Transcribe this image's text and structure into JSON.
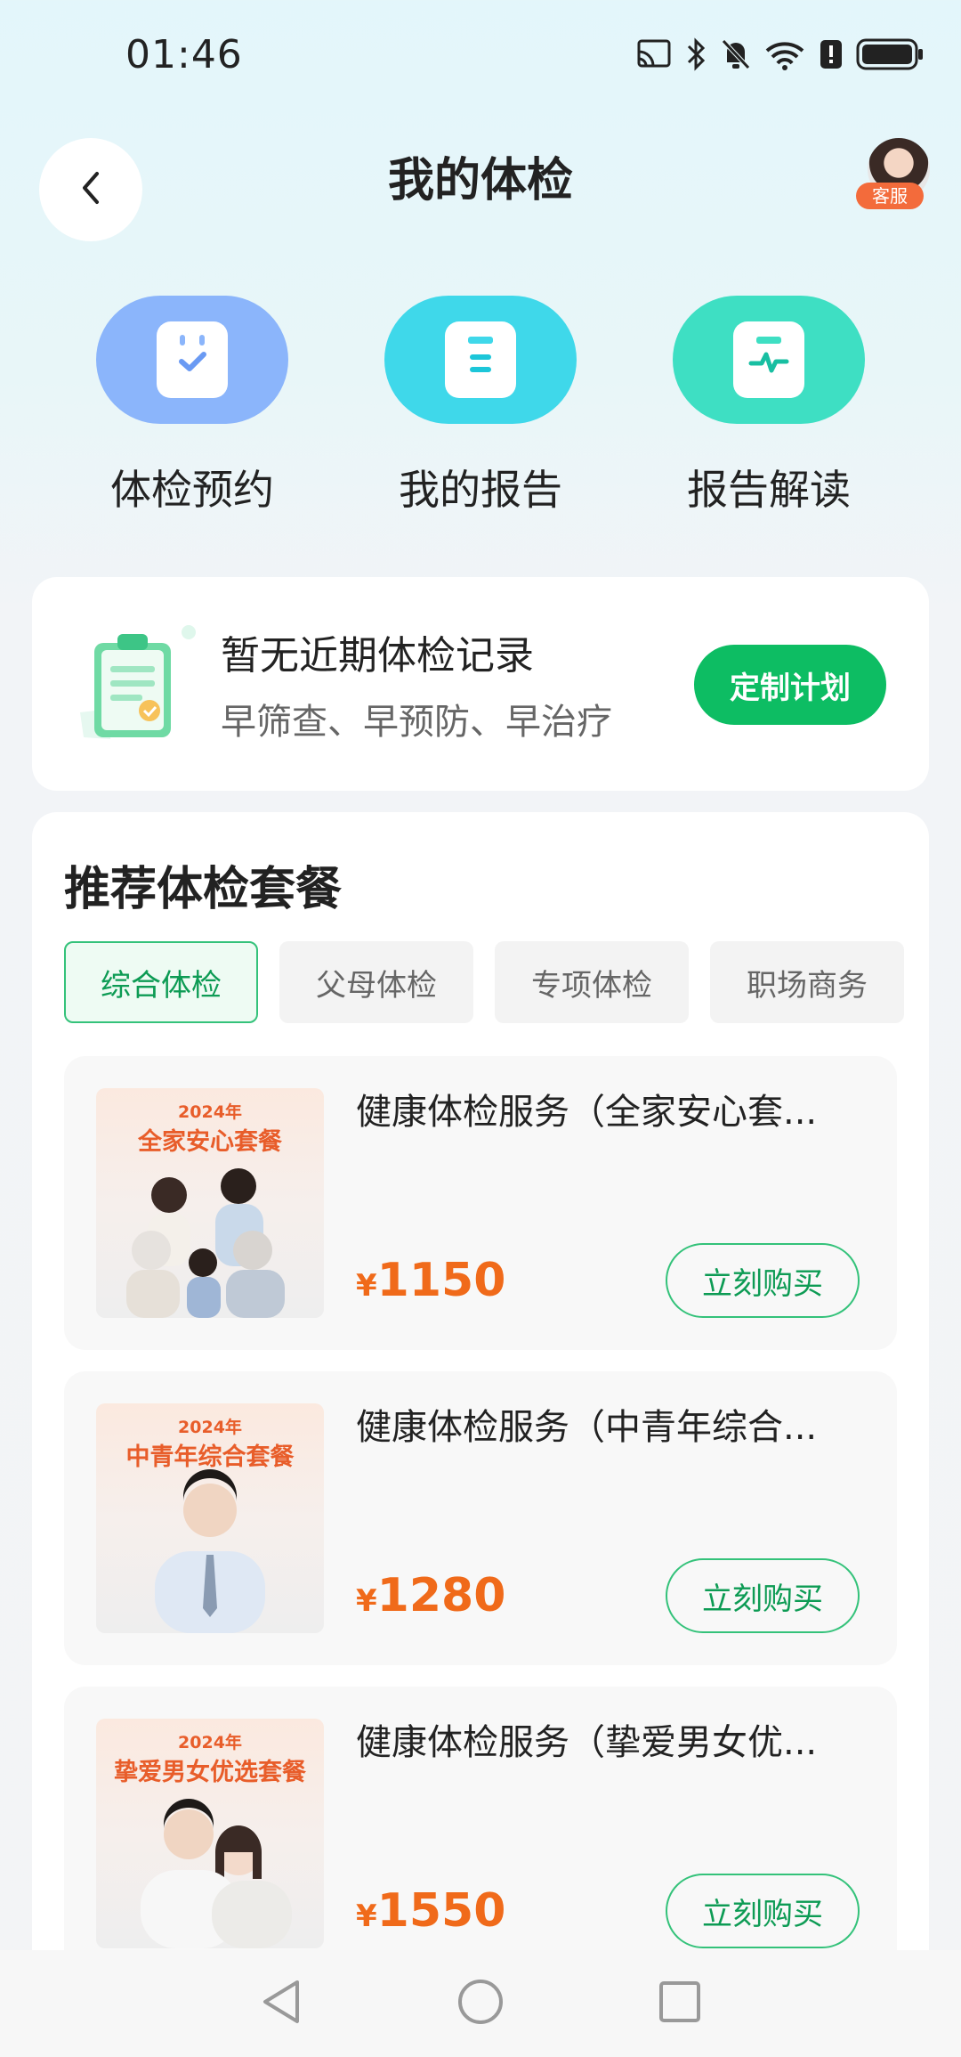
{
  "status_bar": {
    "time": "01:46",
    "icons": [
      "cast-icon",
      "bluetooth-icon",
      "bell-muted-icon",
      "wifi-icon",
      "alert-icon",
      "battery-icon"
    ]
  },
  "header": {
    "title": "我的体检",
    "customer_service_label": "客服"
  },
  "quick_entries": [
    {
      "label": "体检预约",
      "icon": "calendar-check-icon",
      "color": "#8bb5fb"
    },
    {
      "label": "我的报告",
      "icon": "report-list-icon",
      "color": "#3fd8ea"
    },
    {
      "label": "报告解读",
      "icon": "report-pulse-icon",
      "color": "#3edfc3"
    }
  ],
  "record_card": {
    "title": "暂无近期体检记录",
    "subtitle": "早筛查、早预防、早治疗",
    "button": "定制计划"
  },
  "recommend": {
    "title": "推荐体检套餐",
    "tabs": [
      "综合体检",
      "父母体检",
      "专项体检",
      "职场商务"
    ],
    "active_tab": "综合体检",
    "packages": [
      {
        "year": "2024年",
        "image_title": "全家安心套餐",
        "name": "健康体检服务（全家安心套...",
        "currency": "¥",
        "price": "1150",
        "button": "立刻购买"
      },
      {
        "year": "2024年",
        "image_title": "中青年综合套餐",
        "name": "健康体检服务（中青年综合...",
        "currency": "¥",
        "price": "1280",
        "button": "立刻购买"
      },
      {
        "year": "2024年",
        "image_title": "挚爱男女优选套餐",
        "name": "健康体检服务（挚爱男女优...",
        "currency": "¥",
        "price": "1550",
        "button": "立刻购买"
      }
    ]
  },
  "colors": {
    "accent_green": "#0dbd63",
    "price_orange": "#f06a1a"
  }
}
